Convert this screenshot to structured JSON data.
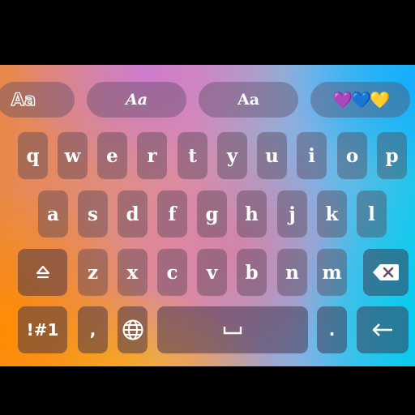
{
  "styles_bar": {
    "items": [
      {
        "label": "Aa",
        "icon": "font-outline-icon"
      },
      {
        "label": "Aa",
        "icon": "font-script-icon"
      },
      {
        "label": "Aa",
        "icon": "font-blackletter-icon"
      },
      {
        "label": "💜💙💛",
        "icon": "hearts-icon"
      }
    ]
  },
  "rows": {
    "row1": [
      "q",
      "w",
      "e",
      "r",
      "t",
      "y",
      "u",
      "i",
      "o",
      "p"
    ],
    "row2": [
      "a",
      "s",
      "d",
      "f",
      "g",
      "h",
      "j",
      "k",
      "l"
    ],
    "row3": [
      "z",
      "x",
      "c",
      "v",
      "b",
      "n",
      "m"
    ]
  },
  "keys": {
    "shift_icon": "shift-icon",
    "backspace_icon": "backspace-icon",
    "symbols_label": "!#1",
    "comma_label": ",",
    "globe_icon": "globe-icon",
    "space_icon": "space-icon",
    "period_label": ".",
    "enter_icon": "enter-icon"
  },
  "colors": {
    "key_bg": "#50414f",
    "text": "#ffffff",
    "gradient": [
      "#ff8c00",
      "#ffbe00",
      "#d98fa6",
      "#14aaff",
      "#00cdf0"
    ]
  }
}
